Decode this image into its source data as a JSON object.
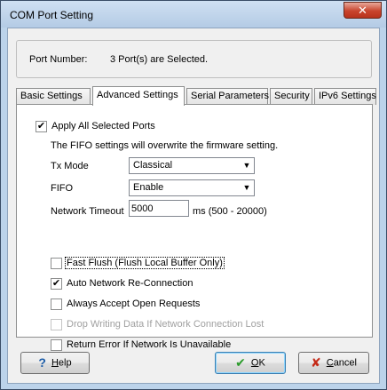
{
  "window": {
    "title": "COM Port Setting",
    "close_glyph": "✕"
  },
  "port": {
    "label": "Port Number:",
    "value": "3 Port(s) are Selected."
  },
  "tabs": [
    {
      "label": "Basic Settings"
    },
    {
      "label": "Advanced Settings",
      "active": true
    },
    {
      "label": "Serial Parameters"
    },
    {
      "label": "Security"
    },
    {
      "label": "IPv6 Settings"
    }
  ],
  "advanced": {
    "apply_all": {
      "label": "Apply All Selected Ports",
      "checked": true
    },
    "fifo_note": "The FIFO settings will overwrite the firmware setting.",
    "tx_mode": {
      "label": "Tx Mode",
      "value": "Classical"
    },
    "fifo": {
      "label": "FIFO",
      "value": "Enable"
    },
    "network_timeout": {
      "label": "Network Timeout",
      "value": "5000",
      "unit": "ms (500 - 20000)"
    },
    "options": [
      {
        "label": "Fast Flush (Flush Local Buffer Only)",
        "checked": false,
        "enabled": true,
        "focused": true
      },
      {
        "label": "Auto Network Re-Connection",
        "checked": true,
        "enabled": true
      },
      {
        "label": "Always Accept Open Requests",
        "checked": false,
        "enabled": true
      },
      {
        "label": "Drop Writing Data If Network Connection Lost",
        "checked": false,
        "enabled": false
      },
      {
        "label": "Return Error If Network Is Unavailable",
        "checked": false,
        "enabled": true
      }
    ]
  },
  "buttons": {
    "help": {
      "label_prefix": "",
      "label_accel": "H",
      "label_rest": "elp",
      "icon": "question-icon",
      "glyph": "?"
    },
    "ok": {
      "label_accel": "O",
      "label_rest": "K",
      "icon": "checkmark-icon",
      "glyph": "✔"
    },
    "cancel": {
      "label_accel": "C",
      "label_rest": "ancel",
      "icon": "x-icon",
      "glyph": "✘"
    }
  },
  "check_glyph": "✔",
  "dropdown_glyph": "▼"
}
